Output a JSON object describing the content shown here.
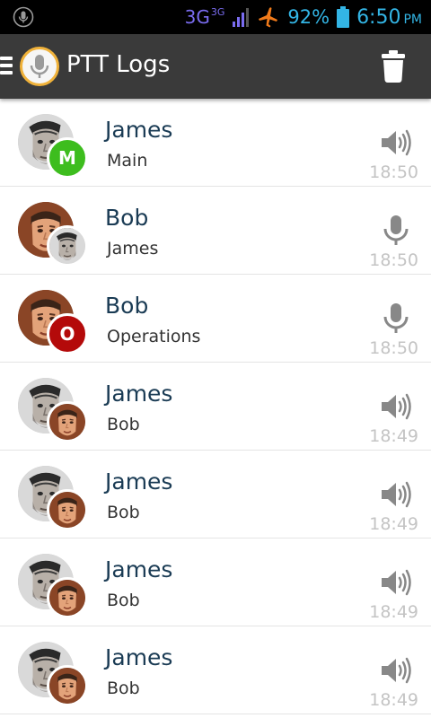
{
  "status_bar": {
    "network": "3G",
    "network_secondary": "3G",
    "battery_percent": "92%",
    "time": "6:50",
    "time_suffix": "PM",
    "icons": [
      "mic-notification-icon",
      "signal-icon",
      "airplane-icon",
      "battery-icon"
    ]
  },
  "action_bar": {
    "title": "PTT Logs",
    "icons": [
      "menu-icon",
      "app-logo-icon",
      "trash-icon"
    ]
  },
  "colors": {
    "accent": "#33b5e5",
    "action_bar_bg": "#3a3a3a",
    "name_text": "#1a3b54",
    "time_text": "#c4c4c4",
    "badge_green": "#3dbd1e",
    "badge_red": "#b40a0a",
    "logo_ring": "#f0b23a"
  },
  "logs": [
    {
      "name": "James",
      "sub": "Main",
      "time": "18:50",
      "type": "speaker",
      "avatar": "james",
      "badge": {
        "kind": "letter",
        "letter": "M",
        "color": "#3dbd1e"
      }
    },
    {
      "name": "Bob",
      "sub": "James",
      "time": "18:50",
      "type": "mic",
      "avatar": "bob",
      "badge": {
        "kind": "photo",
        "person": "james"
      }
    },
    {
      "name": "Bob",
      "sub": "Operations",
      "time": "18:50",
      "type": "mic",
      "avatar": "bob",
      "badge": {
        "kind": "letter",
        "letter": "O",
        "color": "#b40a0a"
      }
    },
    {
      "name": "James",
      "sub": "Bob",
      "time": "18:49",
      "type": "speaker",
      "avatar": "james",
      "badge": {
        "kind": "photo",
        "person": "bob"
      }
    },
    {
      "name": "James",
      "sub": "Bob",
      "time": "18:49",
      "type": "speaker",
      "avatar": "james",
      "badge": {
        "kind": "photo",
        "person": "bob"
      }
    },
    {
      "name": "James",
      "sub": "Bob",
      "time": "18:49",
      "type": "speaker",
      "avatar": "james",
      "badge": {
        "kind": "photo",
        "person": "bob"
      }
    },
    {
      "name": "James",
      "sub": "Bob",
      "time": "18:49",
      "type": "speaker",
      "avatar": "james",
      "badge": {
        "kind": "photo",
        "person": "bob"
      }
    }
  ]
}
